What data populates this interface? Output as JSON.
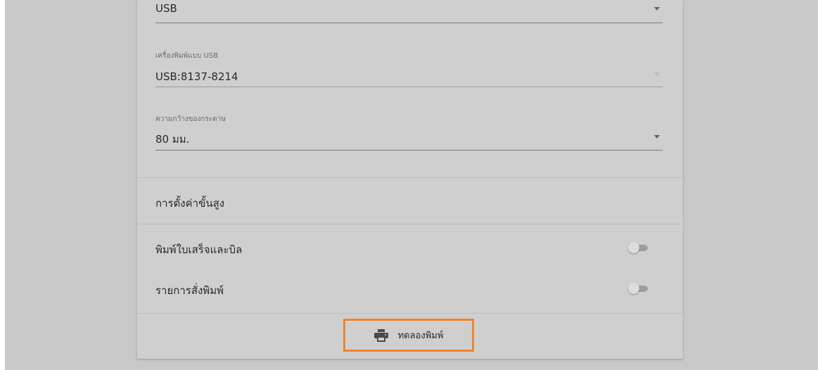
{
  "printer_settings": {
    "connection_field": {
      "value": "USB"
    },
    "usb_printer_field": {
      "label": "เครื่องพิมพ์แบบ USB",
      "value": "USB:8137-8214"
    },
    "paper_width_field": {
      "label": "ความกว้างของกระดาษ",
      "value": "80 มม."
    },
    "advanced_settings_label": "การตั้งค่าขั้นสูง",
    "toggles": [
      {
        "label": "พิมพ์ใบเสร็จและบิล",
        "enabled": false
      },
      {
        "label": "รายการสั่งพิมพ์",
        "enabled": false
      }
    ],
    "test_print_button": {
      "label": "ทดลองพิมพ์",
      "icon": "printer-icon",
      "highlight_color": "#f0842c"
    }
  }
}
